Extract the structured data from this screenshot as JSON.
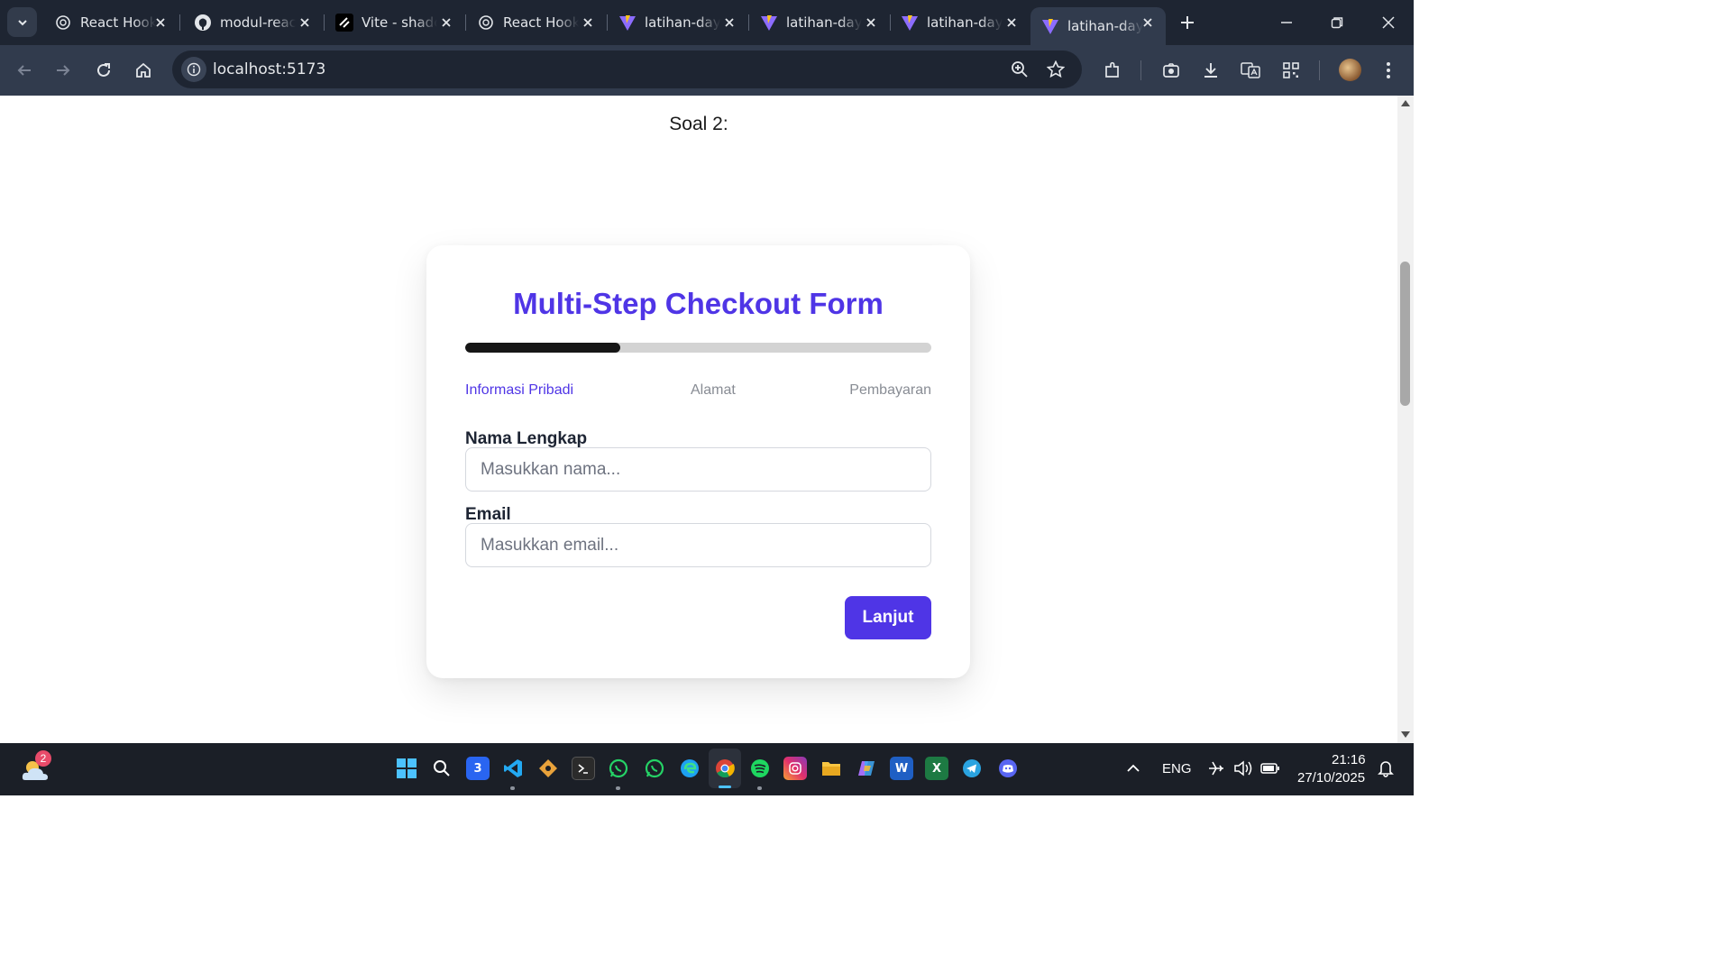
{
  "browser": {
    "tabs": [
      {
        "title": "React Hooks",
        "icon": "openai-icon"
      },
      {
        "title": "modul-react",
        "icon": "github-icon"
      },
      {
        "title": "Vite - shadcn",
        "icon": "shadcn-icon"
      },
      {
        "title": "React Hooks",
        "icon": "openai-icon"
      },
      {
        "title": "latihan-day",
        "icon": "vite-icon"
      },
      {
        "title": "latihan-day",
        "icon": "vite-icon"
      },
      {
        "title": "latihan-day",
        "icon": "vite-icon"
      },
      {
        "title": "latihan-day",
        "icon": "vite-icon",
        "active": true
      }
    ],
    "url": "localhost:5173"
  },
  "page": {
    "heading": "Soal 2:",
    "form": {
      "title": "Multi-Step Checkout Form",
      "progress_fraction": 0.333,
      "steps": [
        "Informasi Pribadi",
        "Alamat",
        "Pembayaran"
      ],
      "active_step": 0,
      "fields": [
        {
          "label": "Nama Lengkap",
          "placeholder": "Masukkan nama...",
          "value": ""
        },
        {
          "label": "Email",
          "placeholder": "Masukkan email...",
          "value": ""
        }
      ],
      "next_button": "Lanjut"
    }
  },
  "taskbar": {
    "weather_badge": "2",
    "language": "ENG",
    "time": "21:16",
    "date": "27/10/2025"
  },
  "colors": {
    "accent": "#4f35e6",
    "progress_fill": "#161616",
    "progress_track": "#d3d3d3",
    "chrome_dark": "#1e2532",
    "chrome_toolbar": "#313b4d"
  }
}
